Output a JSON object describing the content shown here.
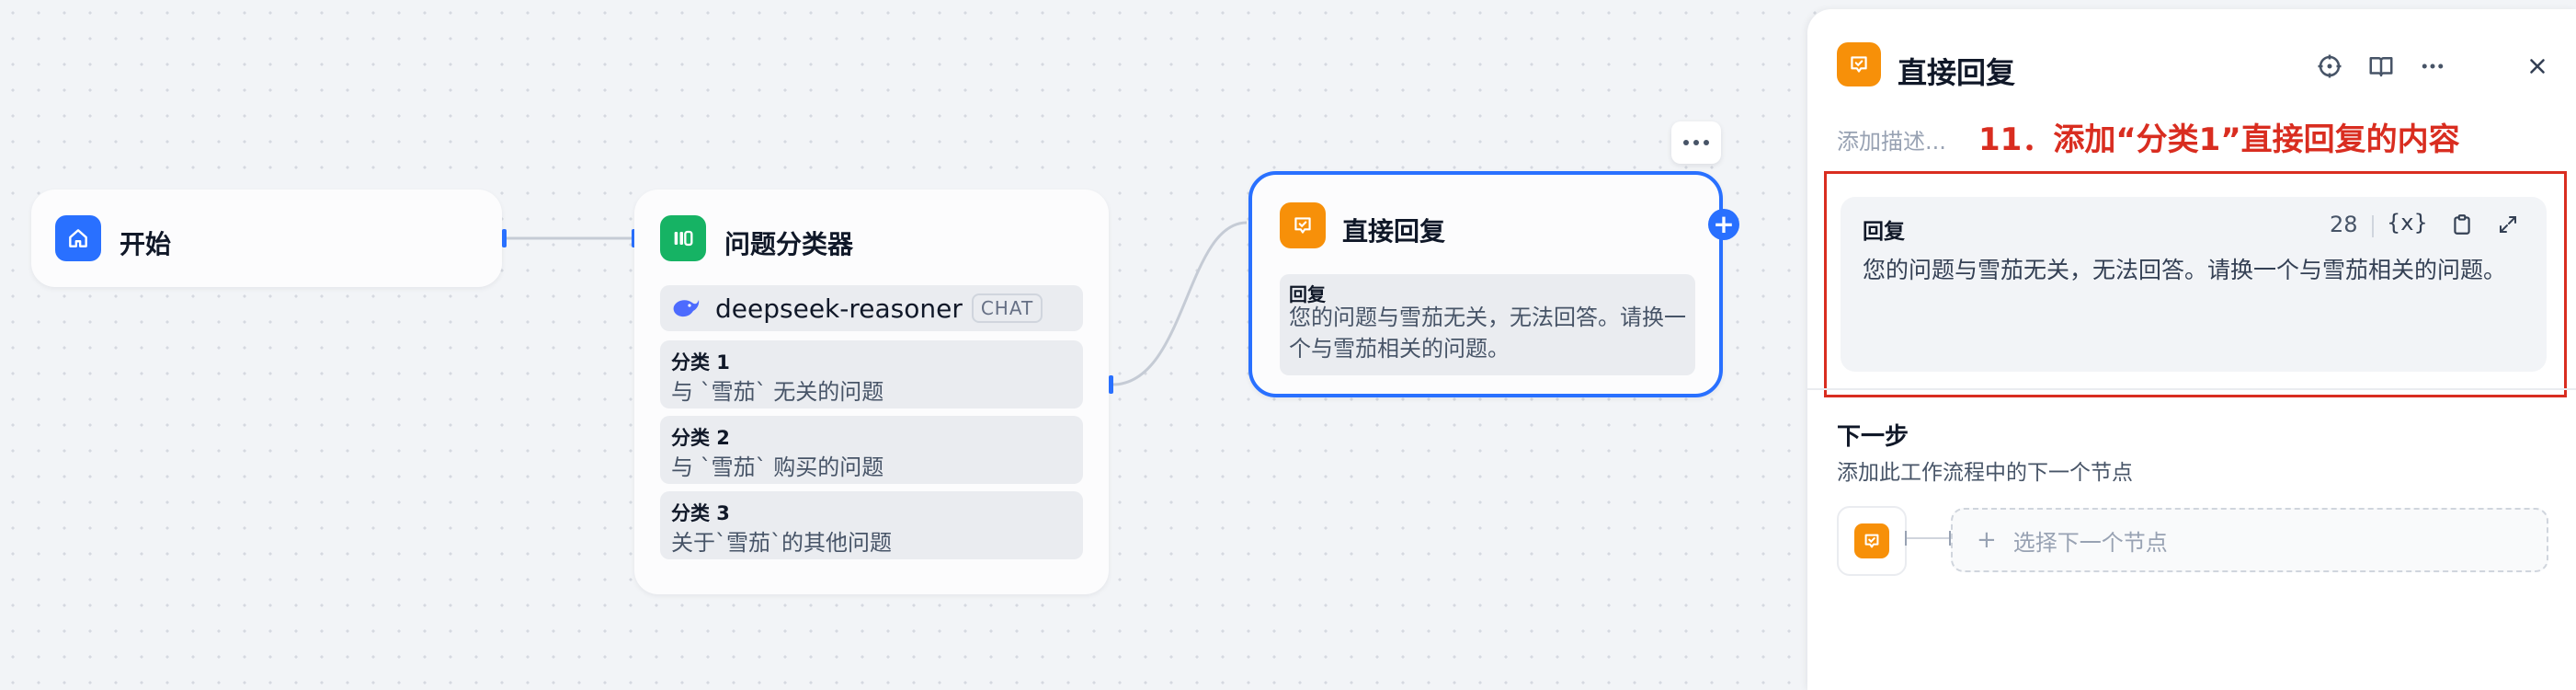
{
  "canvas": {
    "start_node": {
      "title": "开始"
    },
    "classifier_node": {
      "title": "问题分类器",
      "model": {
        "name": "deepseek-reasoner",
        "badge": "CHAT"
      },
      "classes": [
        {
          "title": "分类 1",
          "desc": "与 `雪茄` 无关的问题"
        },
        {
          "title": "分类 2",
          "desc": "与 `雪茄` 购买的问题"
        },
        {
          "title": "分类 3",
          "desc": "关于`雪茄`的其他问题"
        }
      ]
    },
    "reply_node": {
      "title": "直接回复",
      "label": "回复",
      "text": "您的问题与雪茄无关，无法回答。请换一个与雪茄相关的问题。"
    }
  },
  "panel": {
    "title": "直接回复",
    "description_placeholder": "添加描述...",
    "annotation": "11．添加“分类1”直接回复的内容",
    "reply_editor": {
      "label": "回复",
      "char_count": "28",
      "var_button": "{x}",
      "text": "您的问题与雪茄无关，无法回答。请换一个与雪茄相关的问题。"
    },
    "next_step": {
      "title": "下一步",
      "desc": "添加此工作流程中的下一个节点",
      "select_label": "选择下一个节点"
    }
  },
  "colors": {
    "accent_blue": "#2970ff",
    "start_icon": "#2970ff",
    "classifier_icon": "#16b364",
    "reply_icon": "#f79009",
    "annotation_red": "#d92d20"
  }
}
